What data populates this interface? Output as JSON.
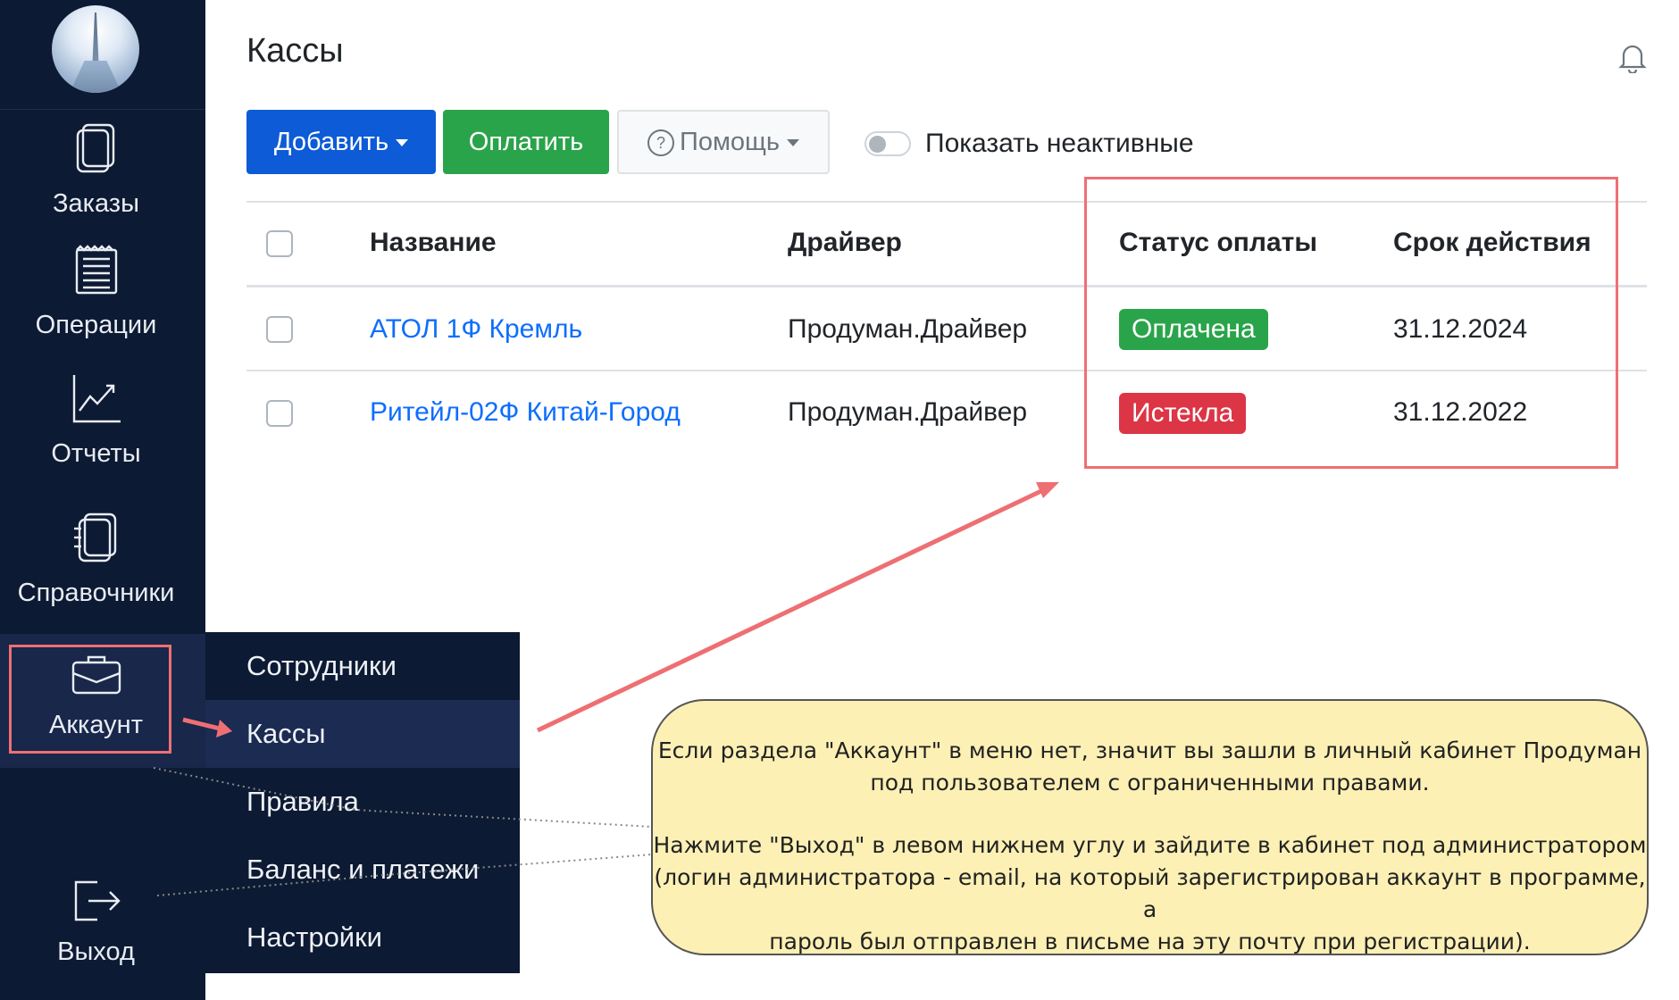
{
  "sidebar": {
    "items": [
      {
        "label": "Заказы",
        "icon": "orders-icon"
      },
      {
        "label": "Операции",
        "icon": "operations-icon"
      },
      {
        "label": "Отчеты",
        "icon": "reports-icon"
      },
      {
        "label": "Справочники",
        "icon": "directories-icon"
      },
      {
        "label": "Аккаунт",
        "icon": "briefcase-icon"
      },
      {
        "label": "Выход",
        "icon": "logout-icon"
      }
    ]
  },
  "submenu": {
    "items": [
      {
        "label": "Сотрудники"
      },
      {
        "label": "Кассы"
      },
      {
        "label": "Правила"
      },
      {
        "label": "Баланс и платежи"
      },
      {
        "label": "Настройки"
      }
    ]
  },
  "header": {
    "title": "Кассы"
  },
  "toolbar": {
    "add_label": "Добавить",
    "pay_label": "Оплатить",
    "help_label": "Помощь",
    "show_inactive_label": "Показать неактивные"
  },
  "table": {
    "columns": [
      "Название",
      "Драйвер",
      "Статус оплаты",
      "Срок действия"
    ],
    "rows": [
      {
        "name": "АТОЛ 1Ф Кремль",
        "driver": "Продуман.Драйвер",
        "status": "Оплачена",
        "expires": "31.12.2024"
      },
      {
        "name": "Ритейл-02Ф Китай-Город",
        "driver": "Продуман.Драйвер",
        "status": "Истекла",
        "expires": "31.12.2022"
      }
    ]
  },
  "note": {
    "line1": "Если раздела \"Аккаунт\" в меню нет, значит вы зашли в личный кабинет Продуман",
    "line2": "под пользователем с ограниченными правами.",
    "line3": "Нажмите \"Выход\" в левом нижнем углу и зайдите в кабинет под администратором",
    "line4": "(логин администратора - email, на который зарегистрирован аккаунт в программе, а",
    "line5": "пароль был отправлен в письме на эту почту при регистрации)."
  },
  "colors": {
    "sidebar": "#0d1a33",
    "primary": "#0d5bd6",
    "success": "#2aa44a",
    "danger": "#dc3545",
    "link": "#0d6efd",
    "annotation": "#ee6f73",
    "note_bg": "#fdf0b5"
  }
}
